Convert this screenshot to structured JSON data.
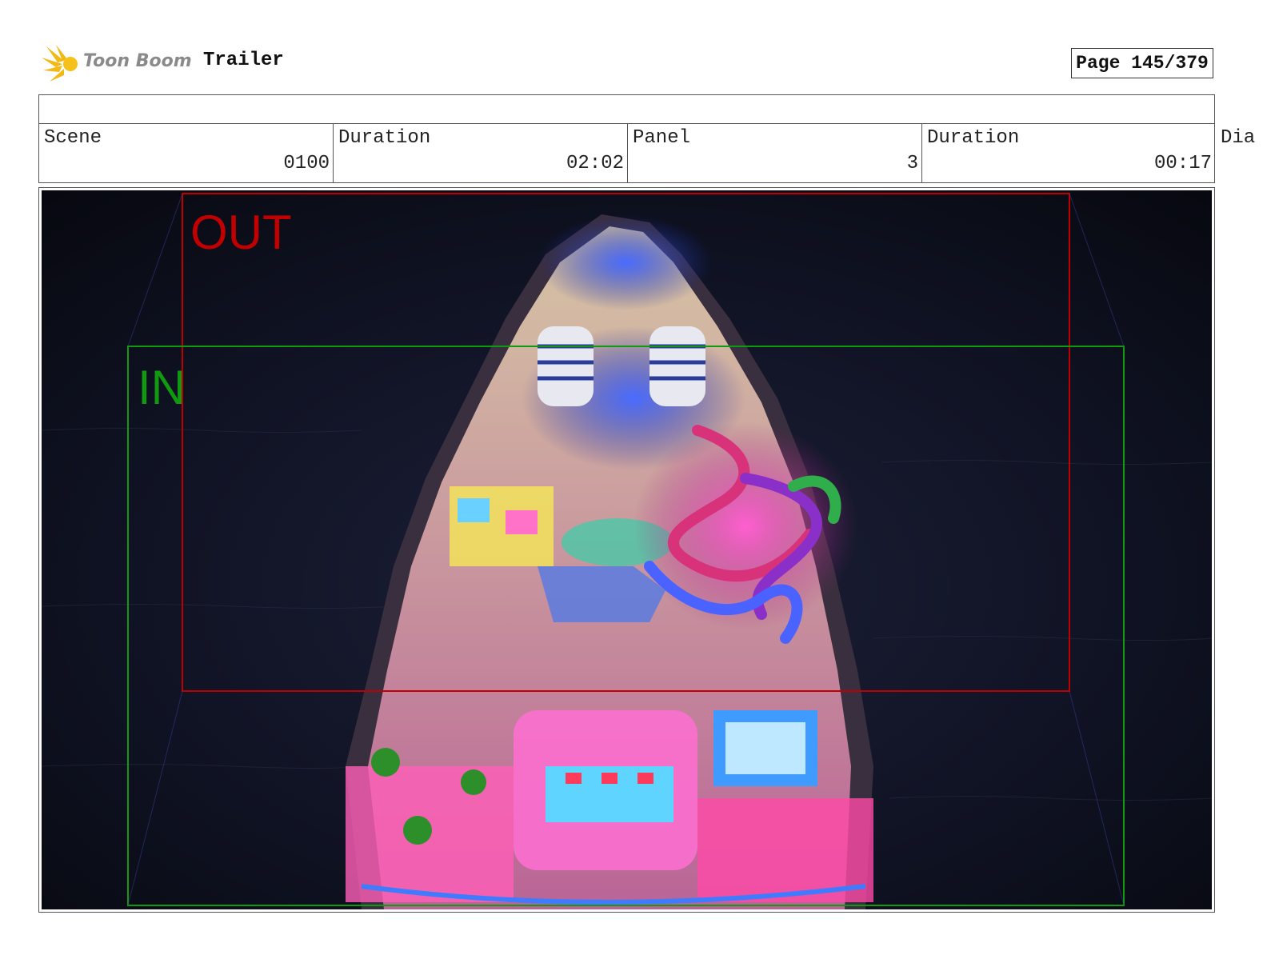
{
  "header": {
    "logo_text": "Toon Boom",
    "project_title": "Trailer",
    "page_label": "Page 145/379"
  },
  "info": {
    "scene_label": "Scene",
    "scene_value": "0100",
    "scene_duration_label": "Duration",
    "scene_duration_value": "02:02",
    "panel_label": "Panel",
    "panel_value": "3",
    "panel_duration_label": "Duration",
    "panel_duration_value": "00:17",
    "dialogue_label": "Dia"
  },
  "panel": {
    "out_label": "OUT",
    "in_label": "IN",
    "out_color": "#c00000",
    "in_color": "#119911",
    "image_subject": "cruise-ship-at-night-aerial"
  }
}
